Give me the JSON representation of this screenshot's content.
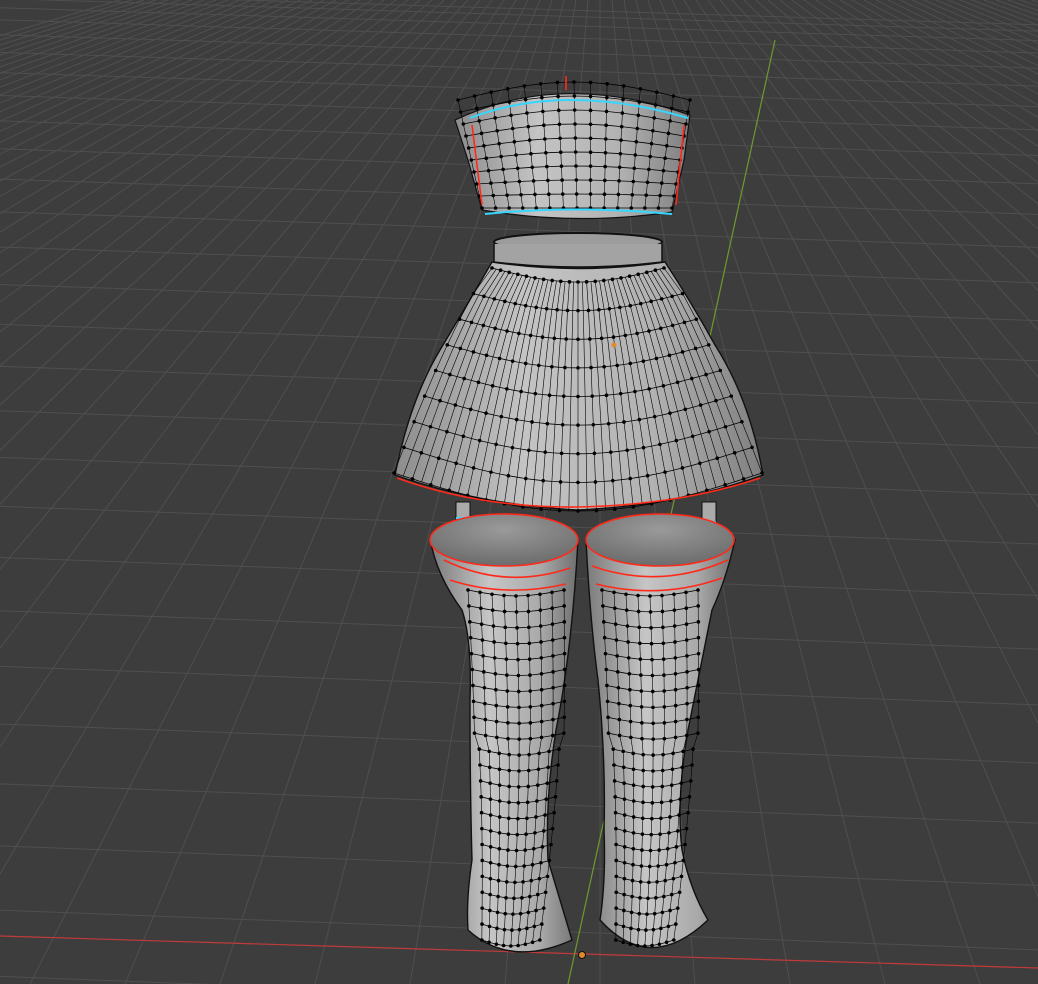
{
  "app": {
    "name": "",
    "mode": "edit-mode"
  },
  "viewport": {
    "background_color": "#3d3d3d",
    "grid_color": "#4f4f4f",
    "x_axis_color": "#c23a3a",
    "y_axis_color": "#6e9a2d",
    "mesh_fill": "#a8a8a8",
    "mesh_shade": "#8a8a8a",
    "wire_color": "#000000",
    "seam_color": "#ff2a1a",
    "selected_edge_color": "#37d6ff",
    "origin_color": "#e08a2a",
    "objects": [
      {
        "name": "top-mesh"
      },
      {
        "name": "skirt-mesh"
      },
      {
        "name": "left-stocking-mesh"
      },
      {
        "name": "right-stocking-mesh"
      }
    ]
  }
}
